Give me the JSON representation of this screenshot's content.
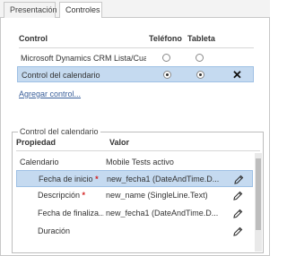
{
  "tabs": [
    {
      "label": "Presentación",
      "active": false
    },
    {
      "label": "Controles",
      "active": true
    }
  ],
  "controls_grid": {
    "headers": {
      "control": "Control",
      "telefono": "Teléfono",
      "tableta": "Tableta"
    },
    "rows": [
      {
        "label": "Microsoft Dynamics CRM Lista/Cuadrí...",
        "telefono": false,
        "tableta": false,
        "selected": false
      },
      {
        "label": "Control del calendario",
        "telefono": true,
        "tableta": true,
        "selected": true
      }
    ],
    "delete_icon": "close-x-icon"
  },
  "add_control_link": "Agregar control...",
  "properties": {
    "legend": "Control del calendario",
    "headers": {
      "propiedad": "Propiedad",
      "valor": "Valor"
    },
    "rows": [
      {
        "name": "Calendario",
        "value": "Mobile Tests activo",
        "required": false,
        "indent": false,
        "selected": false,
        "editable": false
      },
      {
        "name": "Fecha de inicio",
        "value": "new_fecha1 (DateAndTime.D...",
        "required": true,
        "indent": true,
        "selected": true,
        "editable": true
      },
      {
        "name": "Descripción",
        "value": "new_name (SingleLine.Text)",
        "required": true,
        "indent": true,
        "selected": false,
        "editable": true
      },
      {
        "name": "Fecha de finaliza...",
        "value": "new_fecha1 (DateAndTime.D...",
        "required": false,
        "indent": true,
        "selected": false,
        "editable": true
      },
      {
        "name": "Duración",
        "value": "",
        "required": false,
        "indent": true,
        "selected": false,
        "editable": true
      }
    ],
    "edit_icon": "pencil-icon"
  },
  "colors": {
    "selection": "#c5daf0",
    "link": "#3a5f9a",
    "required": "#d32020"
  }
}
